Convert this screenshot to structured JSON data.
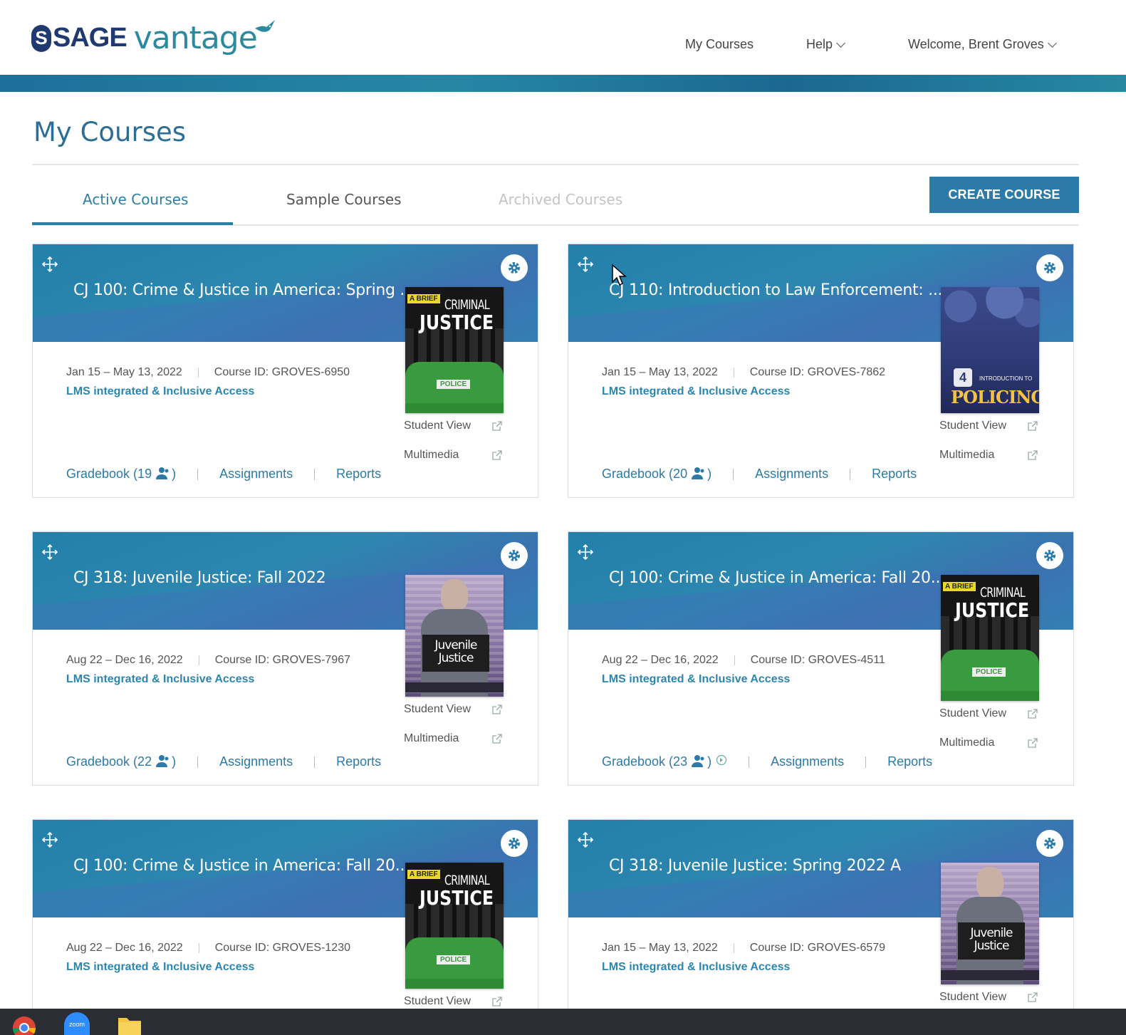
{
  "header": {
    "logo_s": "S",
    "logo_sage": "SAGE",
    "logo_vantage": "vantage",
    "nav": {
      "my_courses": "My Courses",
      "help": "Help",
      "welcome": "Welcome, Brent Groves"
    }
  },
  "page": {
    "title": "My Courses"
  },
  "tabs": [
    {
      "label": "Active Courses",
      "state": "active"
    },
    {
      "label": "Sample Courses",
      "state": "normal"
    },
    {
      "label": "Archived Courses",
      "state": "disabled"
    }
  ],
  "create_button": "CREATE COURSE",
  "colors": {
    "brand_blue": "#2c7aa8",
    "header_stripe": "#1e6f9a",
    "link_blue": "#2c86b0"
  },
  "course_labels": {
    "student_view": "Student View",
    "multimedia": "Multimedia",
    "assignments": "Assignments",
    "reports": "Reports",
    "lms": "LMS integrated & Inclusive Access"
  },
  "courses": [
    {
      "title": "CJ 100: Crime & Justice in America: Spring ...",
      "dates": "Jan 15 – May 13, 2022",
      "course_id": "Course ID: GROVES-6950",
      "gradebook_prefix": "Gradebook (19",
      "gradebook_suffix": ")",
      "book": "criminal-justice"
    },
    {
      "title": "CJ 110: Introduction to Law Enforcement: ...",
      "dates": "Jan 15 – May 13, 2022",
      "course_id": "Course ID: GROVES-7862",
      "gradebook_prefix": "Gradebook (20",
      "gradebook_suffix": ")",
      "book": "policing"
    },
    {
      "title": "CJ 318: Juvenile Justice: Fall 2022",
      "dates": "Aug 22 – Dec 16, 2022",
      "course_id": "Course ID: GROVES-7967",
      "gradebook_prefix": "Gradebook (22",
      "gradebook_suffix": ")",
      "book": "juvenile-justice"
    },
    {
      "title": "CJ 100: Crime & Justice in America: Fall 20...",
      "dates": "Aug 22 – Dec 16, 2022",
      "course_id": "Course ID: GROVES-4511",
      "gradebook_prefix": "Gradebook (23",
      "gradebook_suffix": ")",
      "book": "criminal-justice"
    },
    {
      "title": "CJ 100: Crime & Justice in America: Fall 20...",
      "dates": "Aug 22 – Dec 16, 2022",
      "course_id": "Course ID: GROVES-1230",
      "book": "criminal-justice"
    },
    {
      "title": "CJ 318: Juvenile Justice: Spring 2022 A",
      "dates": "Jan 15 – May 13, 2022",
      "course_id": "Course ID: GROVES-6579",
      "book": "juvenile-justice"
    }
  ],
  "book_covers": {
    "cj_brief": "A BRIEF",
    "cj_criminal": "CRIMINAL",
    "cj_justice": "JUSTICE",
    "cj_police": "POLICE",
    "jj_title": "Juvenile Justice",
    "pol_num": "4",
    "pol_intro": "INTRODUCTION TO",
    "pol_title": "POLICING"
  },
  "taskbar": {
    "icons": [
      "chrome-icon",
      "zoom-icon",
      "file-explorer-icon"
    ],
    "zoom_label": "zoom"
  }
}
